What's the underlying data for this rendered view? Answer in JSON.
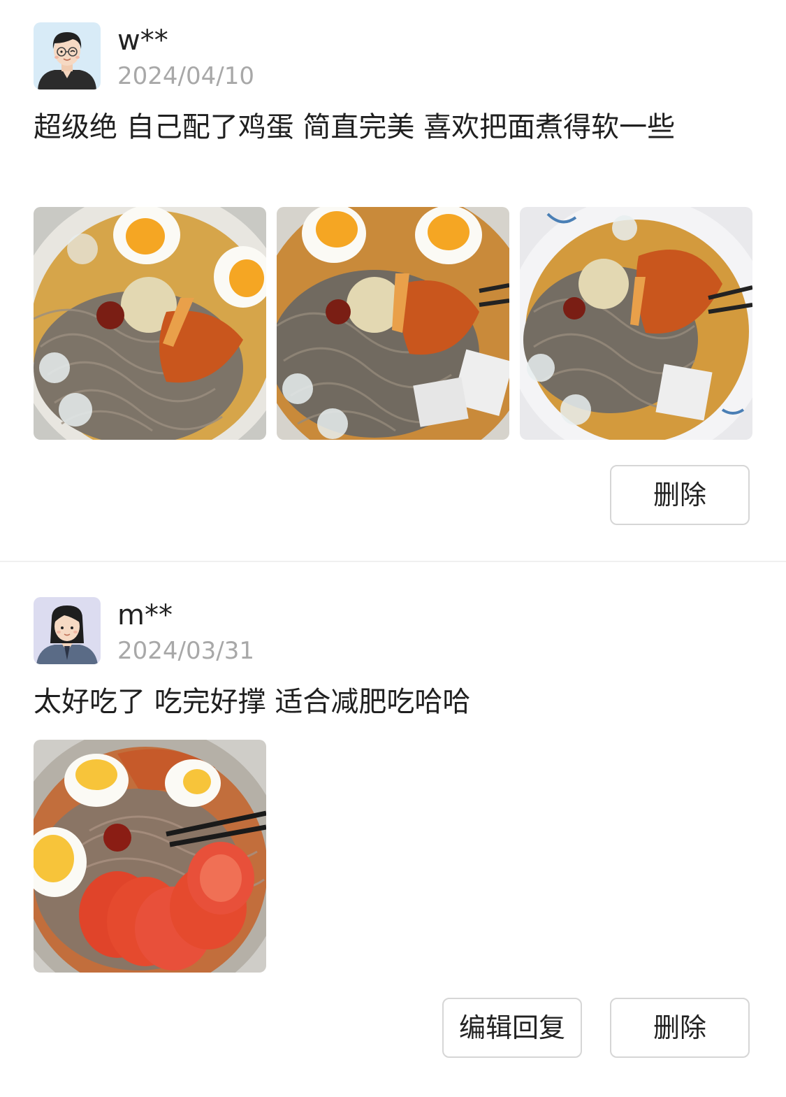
{
  "reviews": [
    {
      "username": "w**",
      "date": "2024/04/10",
      "comment": "超级绝 自己配了鸡蛋 简直完美 喜欢把面煮得软一些",
      "photo_count": 3,
      "actions": {
        "delete_label": "删除"
      }
    },
    {
      "username": "m**",
      "date": "2024/03/31",
      "comment": "太好吃了 吃完好撑 适合减肥吃哈哈",
      "photo_count": 1,
      "actions": {
        "edit_reply_label": "编辑回复",
        "delete_label": "删除"
      }
    }
  ],
  "colors": {
    "text": "#1f1f1f",
    "date": "#a8a8a8",
    "button_border": "#d6d6d6",
    "divider": "#f0f0f0"
  },
  "icons": [
    "avatar-man-glasses-icon",
    "avatar-woman-icon"
  ]
}
